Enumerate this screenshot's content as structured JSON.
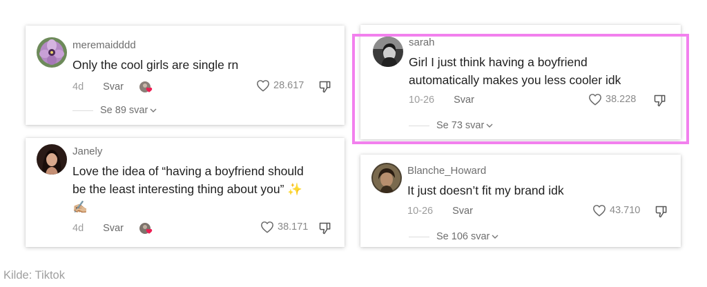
{
  "comments": [
    {
      "username": "meremaidddd",
      "text": "Only the cool girls are single rn",
      "date": "4d",
      "reply_label": "Svar",
      "likes": "28.617",
      "view_replies": "Se 89 svar"
    },
    {
      "username": "Janely",
      "text_line1": "Love the idea of “having a boyfriend should",
      "text_line2": "be the least interesting thing about you” ✨",
      "text_line3": "✍🏼",
      "date": "4d",
      "reply_label": "Svar",
      "likes": "38.171"
    },
    {
      "username": "sarah",
      "text_line1": "Girl I just think having a boyfriend",
      "text_line2": "automatically makes you less cooler idk",
      "date": "10-26",
      "reply_label": "Svar",
      "likes": "38.228",
      "view_replies": "Se 73 svar"
    },
    {
      "username": "Blanche_Howard",
      "text": "It just doesn’t fit my brand idk",
      "date": "10-26",
      "reply_label": "Svar",
      "likes": "43.710",
      "view_replies": "Se 106 svar"
    }
  ],
  "icons": {
    "like": "heart-outline-icon",
    "dislike": "thumbs-down-icon",
    "expand": "chevron-down-icon",
    "creator_liked": "creator-liked-heart-icon"
  },
  "colors": {
    "highlight_border": "#f280ee",
    "creator_heart": "#ee1d52"
  },
  "source_caption": "Kilde: Tiktok"
}
